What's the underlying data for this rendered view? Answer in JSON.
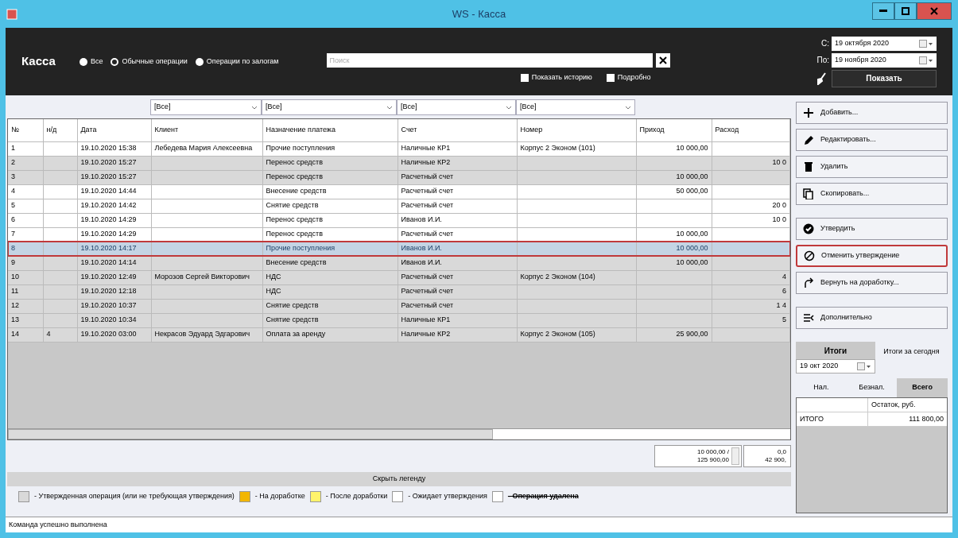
{
  "window": {
    "title": "WS - Касса"
  },
  "header": {
    "title": "Касса",
    "modes": [
      {
        "label": "Все",
        "selected": false
      },
      {
        "label": "Обычные операции",
        "selected": true
      },
      {
        "label": "Операции по залогам",
        "selected": false
      }
    ],
    "search": {
      "placeholder": "Поиск"
    },
    "options": [
      {
        "label": "Показать историю",
        "checked": false
      },
      {
        "label": "Подробно",
        "checked": false
      }
    ],
    "date_from": {
      "label": "С:",
      "value": "19 октября 2020"
    },
    "date_to": {
      "label": "По:",
      "value": "19 ноября 2020"
    },
    "show_button": "Показать"
  },
  "table": {
    "filters": [
      "[Все]",
      "[Все]",
      "[Все]",
      "[Все]"
    ],
    "columns": [
      "№",
      "н/д",
      "Дата",
      "Клиент",
      "Назначение платежа",
      "Счет",
      "Номер",
      "Приход",
      "Расход"
    ],
    "rows": [
      {
        "cells": [
          "1",
          "",
          "19.10.2020 15:38",
          "Лебедева Мария Алексеевна",
          "Прочие поступления",
          "Наличные КР1",
          "Корпус 2 Эконом (101)",
          "10 000,00",
          ""
        ],
        "approved": false,
        "selected": false,
        "highlighted": false
      },
      {
        "cells": [
          "2",
          "",
          "19.10.2020 15:27",
          "",
          "Перенос средств",
          "Наличные КР2",
          "",
          "",
          "10 0"
        ],
        "approved": true,
        "selected": false,
        "highlighted": false
      },
      {
        "cells": [
          "3",
          "",
          "19.10.2020 15:27",
          "",
          "Перенос средств",
          "Расчетный счет",
          "",
          "10 000,00",
          ""
        ],
        "approved": true,
        "selected": false,
        "highlighted": false
      },
      {
        "cells": [
          "4",
          "",
          "19.10.2020 14:44",
          "",
          "Внесение средств",
          "Расчетный счет",
          "",
          "50 000,00",
          ""
        ],
        "approved": false,
        "selected": false,
        "highlighted": false
      },
      {
        "cells": [
          "5",
          "",
          "19.10.2020 14:42",
          "",
          "Снятие средств",
          "Расчетный счет",
          "",
          "",
          "20 0"
        ],
        "approved": false,
        "selected": false,
        "highlighted": false
      },
      {
        "cells": [
          "6",
          "",
          "19.10.2020 14:29",
          "",
          "Перенос средств",
          "Иванов И.И.",
          "",
          "",
          "10 0"
        ],
        "approved": false,
        "selected": false,
        "highlighted": false
      },
      {
        "cells": [
          "7",
          "",
          "19.10.2020 14:29",
          "",
          "Перенос средств",
          "Расчетный счет",
          "",
          "10 000,00",
          ""
        ],
        "approved": false,
        "selected": false,
        "highlighted": false
      },
      {
        "cells": [
          "8",
          "",
          "19.10.2020 14:17",
          "",
          "Прочие поступления",
          "Иванов И.И.",
          "",
          "10 000,00",
          ""
        ],
        "selected": true,
        "highlighted": true
      },
      {
        "cells": [
          "9",
          "",
          "19.10.2020 14:14",
          "",
          "Внесение средств",
          "Иванов И.И.",
          "",
          "10 000,00",
          ""
        ],
        "approved": true,
        "selected": false,
        "highlighted": false
      },
      {
        "cells": [
          "10",
          "",
          "19.10.2020 12:49",
          "Морозов Сергей Викторович",
          "НДС",
          "Расчетный счет",
          "Корпус 2 Эконом (104)",
          "",
          "4"
        ],
        "approved": true,
        "selected": false,
        "highlighted": false
      },
      {
        "cells": [
          "11",
          "",
          "19.10.2020 12:18",
          "",
          "НДС",
          "Расчетный счет",
          "",
          "",
          "6"
        ],
        "approved": true,
        "selected": false,
        "highlighted": false
      },
      {
        "cells": [
          "12",
          "",
          "19.10.2020 10:37",
          "",
          "Снятие средств",
          "Расчетный счет",
          "",
          "",
          "1 4"
        ],
        "approved": true,
        "selected": false,
        "highlighted": false
      },
      {
        "cells": [
          "13",
          "",
          "19.10.2020 10:34",
          "",
          "Снятие средств",
          "Наличные КР1",
          "",
          "",
          "5"
        ],
        "approved": true,
        "selected": false,
        "highlighted": false
      },
      {
        "cells": [
          "14",
          "4",
          "19.10.2020 03:00",
          "Некрасов Эдуард Эдгарович",
          "Оплата за аренду",
          "Наличные КР2",
          "Корпус 2 Эконом (105)",
          "25 900,00",
          ""
        ],
        "approved": true,
        "selected": false,
        "highlighted": false
      }
    ],
    "totals": [
      [
        "10 000,00 /",
        "125 900,00"
      ],
      [
        "0,0",
        "42 900,"
      ]
    ]
  },
  "actions": [
    {
      "kind": "add",
      "label": "Добавить...",
      "highlighted": false
    },
    {
      "kind": "edit",
      "label": "Редактировать...",
      "highlighted": false
    },
    {
      "kind": "delete",
      "label": "Удалить",
      "highlighted": false
    },
    {
      "kind": "copy",
      "label": "Скопировать...",
      "highlighted": false
    },
    {
      "kind": "approve",
      "label": "Утвердить",
      "highlighted": false
    },
    {
      "kind": "unapprove",
      "label": "Отменить утверждение",
      "highlighted": true
    },
    {
      "kind": "return",
      "label": "Вернуть на доработку...",
      "highlighted": false
    },
    {
      "kind": "more",
      "label": "Дополнительно",
      "highlighted": false
    }
  ],
  "summary": {
    "tabs": [
      {
        "label": "Итоги",
        "selected": true
      },
      {
        "label": "Итоги за сегодня",
        "selected": false
      }
    ],
    "date": "19 окт 2020",
    "subtabs": [
      {
        "label": "Нал.",
        "selected": false
      },
      {
        "label": "Безнал.",
        "selected": false
      },
      {
        "label": "Всего",
        "selected": true
      }
    ],
    "column": "Остаток, руб.",
    "rows": [
      {
        "label": "ИТОГО",
        "value": "111 800,00"
      }
    ]
  },
  "legend": {
    "toggle": "Скрыть легенду",
    "items": [
      {
        "color": "#d9d9d9",
        "label": "- Утвержденная операция (или не требующая утверждения)",
        "kind": "normal"
      },
      {
        "color": "#f2b600",
        "label": "- На доработке",
        "kind": "normal"
      },
      {
        "color": "#fff36b",
        "label": "- После доработки",
        "kind": "normal"
      },
      {
        "color": "#ffffff",
        "label": "- Ожидает утверждения",
        "kind": "normal"
      },
      {
        "color": "#ffffff",
        "label": "- Операция удалена",
        "kind": "deleted"
      }
    ]
  },
  "status_bar": "Команда успешно выполнена"
}
